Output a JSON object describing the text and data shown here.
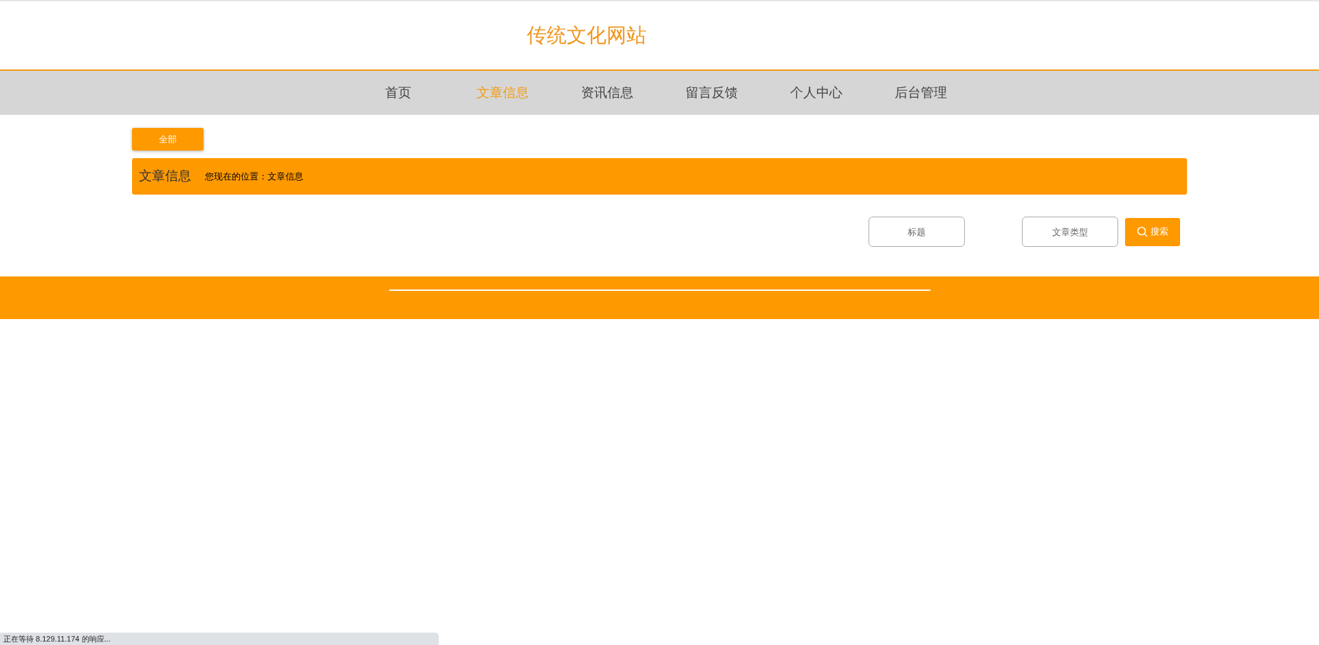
{
  "site_title": "传统文化网站",
  "nav": [
    {
      "label": "首页",
      "selected": false
    },
    {
      "label": "文章信息",
      "selected": true
    },
    {
      "label": "资讯信息",
      "selected": false
    },
    {
      "label": "留言反馈",
      "selected": false
    },
    {
      "label": "个人中心",
      "selected": false
    },
    {
      "label": "后台管理",
      "selected": false
    }
  ],
  "category_buttons": [
    {
      "label": "全部"
    }
  ],
  "banner": {
    "title": "文章信息",
    "breadcrumb": "您现在的位置：文章信息"
  },
  "search": {
    "fields": [
      {
        "placeholder": "标题"
      },
      {
        "placeholder": "文章类型"
      }
    ],
    "button": "搜索"
  },
  "status_bar": "正在等待 8.129.11.174 的响应..."
}
